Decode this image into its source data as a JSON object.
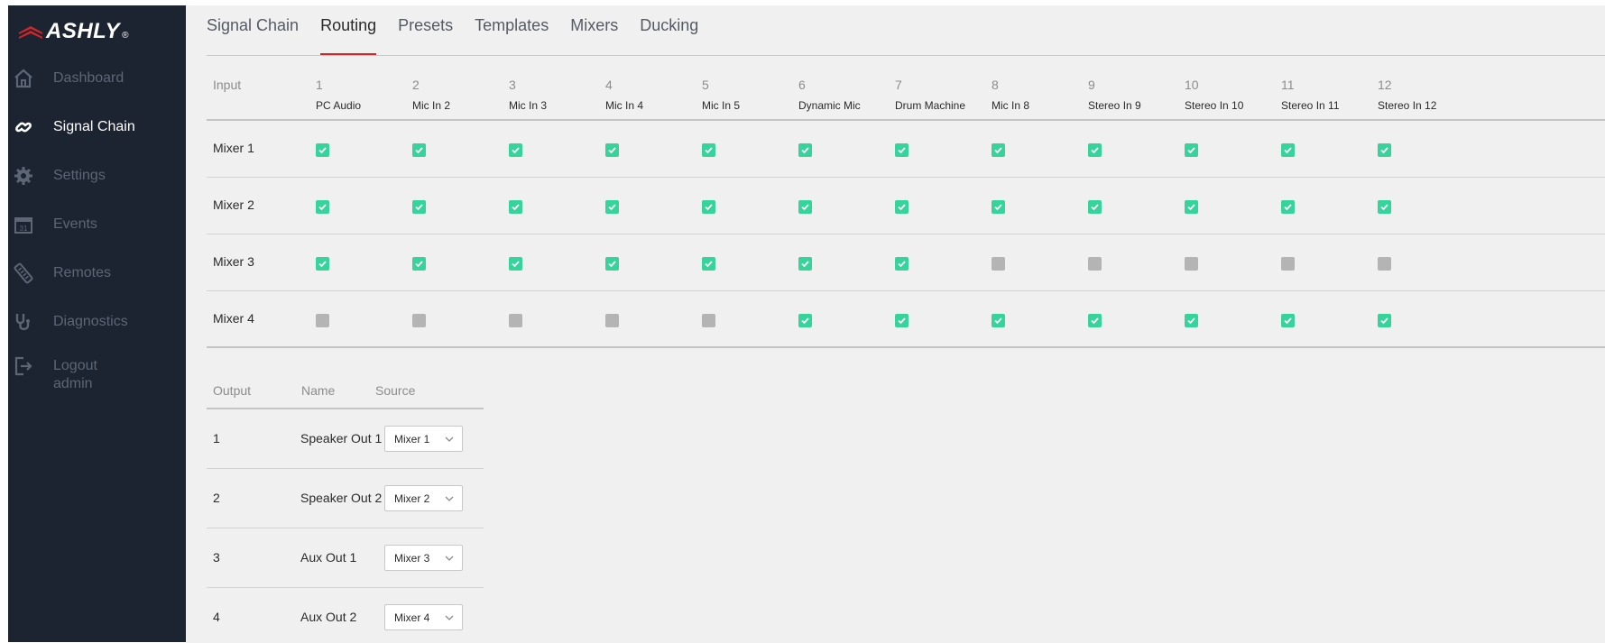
{
  "brand": {
    "name": "ASHLY",
    "reg": "®",
    "accent": "#d0262a"
  },
  "sidebar": {
    "items": [
      {
        "label": "Dashboard",
        "icon": "home-icon",
        "active": false
      },
      {
        "label": "Signal Chain",
        "icon": "chain-link-icon",
        "active": true
      },
      {
        "label": "Settings",
        "icon": "gear-icon",
        "active": false
      },
      {
        "label": "Events",
        "icon": "calendar-icon",
        "active": false
      },
      {
        "label": "Remotes",
        "icon": "remote-icon",
        "active": false
      },
      {
        "label": "Diagnostics",
        "icon": "stethoscope-icon",
        "active": false
      },
      {
        "label": "Logout",
        "sublabel": "admin",
        "icon": "logout-icon",
        "active": false
      }
    ]
  },
  "tabs": [
    "Signal Chain",
    "Routing",
    "Presets",
    "Templates",
    "Mixers",
    "Ducking"
  ],
  "active_tab": "Routing",
  "routing": {
    "header_label": "Input",
    "inputs": [
      {
        "num": "1",
        "name": "PC Audio"
      },
      {
        "num": "2",
        "name": "Mic In 2"
      },
      {
        "num": "3",
        "name": "Mic In 3"
      },
      {
        "num": "4",
        "name": "Mic In 4"
      },
      {
        "num": "5",
        "name": "Mic In 5"
      },
      {
        "num": "6",
        "name": "Dynamic Mic"
      },
      {
        "num": "7",
        "name": "Drum Machine"
      },
      {
        "num": "8",
        "name": "Mic In 8"
      },
      {
        "num": "9",
        "name": "Stereo In 9"
      },
      {
        "num": "10",
        "name": "Stereo In 10"
      },
      {
        "num": "11",
        "name": "Stereo In 11"
      },
      {
        "num": "12",
        "name": "Stereo In 12"
      }
    ],
    "mixers": [
      {
        "label": "Mixer 1",
        "checked": [
          true,
          true,
          true,
          true,
          true,
          true,
          true,
          true,
          true,
          true,
          true,
          true
        ]
      },
      {
        "label": "Mixer 2",
        "checked": [
          true,
          true,
          true,
          true,
          true,
          true,
          true,
          true,
          true,
          true,
          true,
          true
        ]
      },
      {
        "label": "Mixer 3",
        "checked": [
          true,
          true,
          true,
          true,
          true,
          true,
          true,
          false,
          false,
          false,
          false,
          false
        ]
      },
      {
        "label": "Mixer 4",
        "checked": [
          false,
          false,
          false,
          false,
          false,
          true,
          true,
          true,
          true,
          true,
          true,
          true
        ]
      }
    ]
  },
  "outputs": {
    "headers": {
      "output": "Output",
      "name": "Name",
      "source": "Source"
    },
    "rows": [
      {
        "num": "1",
        "name": "Speaker Out 1",
        "source": "Mixer 1"
      },
      {
        "num": "2",
        "name": "Speaker Out 2",
        "source": "Mixer 2"
      },
      {
        "num": "3",
        "name": "Aux Out 1",
        "source": "Mixer 3"
      },
      {
        "num": "4",
        "name": "Aux Out 2",
        "source": "Mixer 4"
      }
    ]
  },
  "colors": {
    "checked": "#36d49a",
    "unchecked": "#b4b4b4",
    "sidebar_bg": "#1c2331"
  }
}
